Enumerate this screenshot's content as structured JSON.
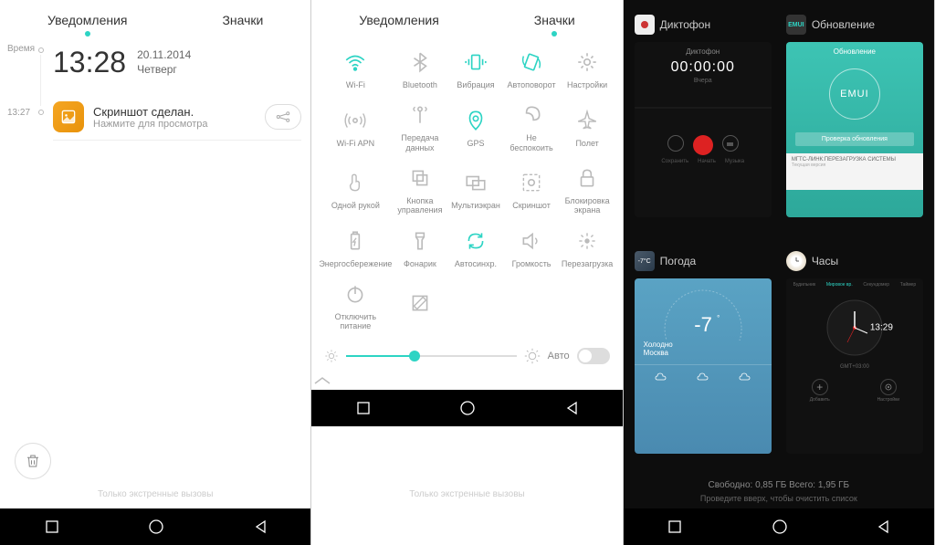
{
  "screen1": {
    "tabs": {
      "notifications": "Уведомления",
      "toggles": "Значки"
    },
    "timeLabel": "Время",
    "time": "13:28",
    "date": "20.11.2014",
    "weekday": "Четверг",
    "notifTime": "13:27",
    "notif": {
      "title": "Скриншот сделан.",
      "sub": "Нажмите для просмотра"
    },
    "emergency": "Только экстренные вызовы"
  },
  "screen2": {
    "tabs": {
      "notifications": "Уведомления",
      "toggles": "Значки"
    },
    "tiles": [
      {
        "name": "wifi",
        "label": "Wi-Fi",
        "active": true
      },
      {
        "name": "bluetooth",
        "label": "Bluetooth",
        "active": false
      },
      {
        "name": "vibration",
        "label": "Вибрация",
        "active": true
      },
      {
        "name": "autorotate",
        "label": "Автоповорот",
        "active": true
      },
      {
        "name": "settings",
        "label": "Настройки",
        "active": false
      },
      {
        "name": "wifiapn",
        "label": "Wi-Fi APN",
        "active": false
      },
      {
        "name": "data",
        "label": "Передача\nданных",
        "active": false
      },
      {
        "name": "gps",
        "label": "GPS",
        "active": true
      },
      {
        "name": "dnd",
        "label": "Не беспокоить",
        "active": false
      },
      {
        "name": "airplane",
        "label": "Полет",
        "active": false
      },
      {
        "name": "onehand",
        "label": "Одной рукой",
        "active": false
      },
      {
        "name": "control",
        "label": "Кнопка\nуправления",
        "active": false
      },
      {
        "name": "multiscreen",
        "label": "Мультиэкран",
        "active": false
      },
      {
        "name": "screenshot",
        "label": "Скриншот",
        "active": false
      },
      {
        "name": "lock",
        "label": "Блокировка\nэкрана",
        "active": false
      },
      {
        "name": "powersave",
        "label": "Энергосбережение",
        "active": false
      },
      {
        "name": "flashlight",
        "label": "Фонарик",
        "active": false
      },
      {
        "name": "autosync",
        "label": "Автосинхр.",
        "active": true
      },
      {
        "name": "volume",
        "label": "Громкость",
        "active": false
      },
      {
        "name": "reboot",
        "label": "Перезагрузка",
        "active": false
      },
      {
        "name": "poweroff",
        "label": "Отключить\nпитание",
        "active": false
      },
      {
        "name": "edit",
        "label": "",
        "active": false
      }
    ],
    "brightness": {
      "auto": "Авто",
      "level": 40
    },
    "emergency": "Только экстренные вызовы"
  },
  "screen3": {
    "apps": [
      {
        "name": "Диктофон",
        "iconStyle": "recorder"
      },
      {
        "name": "Обновление",
        "iconStyle": "emui"
      },
      {
        "name": "Погода",
        "iconStyle": "weather"
      },
      {
        "name": "Часы",
        "iconStyle": "clock"
      }
    ],
    "recorder": {
      "title": "Диктофон",
      "time": "00:00:00",
      "date": "Вчера"
    },
    "update": {
      "brand": "EMUI",
      "btn": "Проверка обновления"
    },
    "weather": {
      "temp": "-7",
      "cond": "Холодно",
      "city": "Москва"
    },
    "clock": {
      "time": "13:29",
      "tz": "GMT+03:00",
      "tabs": [
        "Будильник",
        "Мировое вр.",
        "Секундомер",
        "Таймер"
      ],
      "addLabel": "Добавить",
      "settingsLabel": "Настройки"
    },
    "storage": "Свободно: 0,85 ГБ Всего: 1,95 ГБ",
    "swipeHint": "Проведите вверх, чтобы очистить список"
  }
}
